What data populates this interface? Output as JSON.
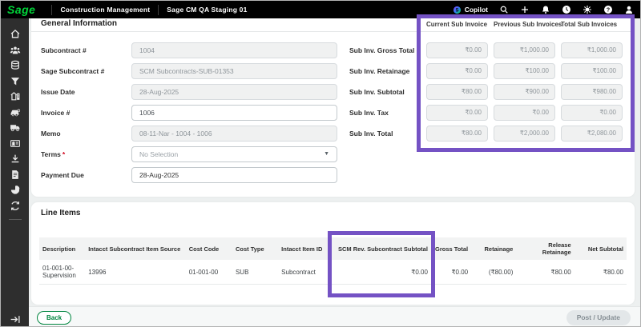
{
  "topbar": {
    "brand": "Sage",
    "app": "Construction Management",
    "env": "Sage CM QA Staging 01",
    "copilot": "Copilot"
  },
  "sidebar": {
    "icons": [
      "home",
      "people",
      "database",
      "filter",
      "property",
      "equipment",
      "truck",
      "id-card",
      "import",
      "invoice",
      "reports",
      "sync"
    ],
    "expand": "expand-sidebar"
  },
  "general_info": {
    "title": "General Information",
    "required_marker": "*",
    "fields": {
      "subcontract": {
        "label": "Subcontract #",
        "value": "1004"
      },
      "sage_subcontract": {
        "label": "Sage Subcontract #",
        "value": "SCM Subcontracts-SUB-01353"
      },
      "issue_date": {
        "label": "Issue Date",
        "value": "28-Aug-2025"
      },
      "invoice": {
        "label": "Invoice #",
        "value": "1006"
      },
      "memo": {
        "label": "Memo",
        "value": "08-11-Nar - 1004 - 1006"
      },
      "terms": {
        "label": "Terms",
        "value": "No Selection"
      },
      "payment_due": {
        "label": "Payment Due",
        "value": "28-Aug-2025"
      }
    },
    "summary": {
      "columns": [
        "Current Sub Invoice",
        "Previous Sub Invoices",
        "Total Sub Invoices"
      ],
      "rows": [
        {
          "label": "Sub Inv. Gross Total",
          "values": [
            "₹0.00",
            "₹1,000.00",
            "₹1,000.00"
          ]
        },
        {
          "label": "Sub Inv. Retainage",
          "values": [
            "₹0.00",
            "₹100.00",
            "₹100.00"
          ]
        },
        {
          "label": "Sub Inv. Subtotal",
          "values": [
            "₹80.00",
            "₹900.00",
            "₹980.00"
          ]
        },
        {
          "label": "Sub Inv. Tax",
          "values": [
            "₹0.00",
            "₹0.00",
            "₹0.00"
          ]
        },
        {
          "label": "Sub Inv. Total",
          "values": [
            "₹80.00",
            "₹2,000.00",
            "₹2,080.00"
          ]
        }
      ]
    }
  },
  "line_items": {
    "title": "Line Items",
    "columns": [
      "Description",
      "Intacct Subcontract Item Source",
      "Cost Code",
      "Cost Type",
      "Intacct Item ID",
      "SCM Rev. Subcontract Subtotal",
      "Gross Total",
      "Retainage",
      "Release Retainage",
      "Net Subtotal"
    ],
    "rows": [
      [
        "01-001-00-Supervision",
        "13996",
        "01-001-00",
        "SUB",
        "Subcontract",
        "₹0.00",
        "₹0.00",
        "(₹80.00)",
        "₹80.00",
        "₹80.00"
      ]
    ]
  },
  "footer": {
    "back": "Back",
    "post": "Post / Update"
  },
  "colors": {
    "topbar_bg": "#000000",
    "brand_green": "#00D639",
    "highlight_purple": "#7452c4",
    "back_button_green": "#00853f",
    "sidebar_bg": "#2e2e2e"
  }
}
